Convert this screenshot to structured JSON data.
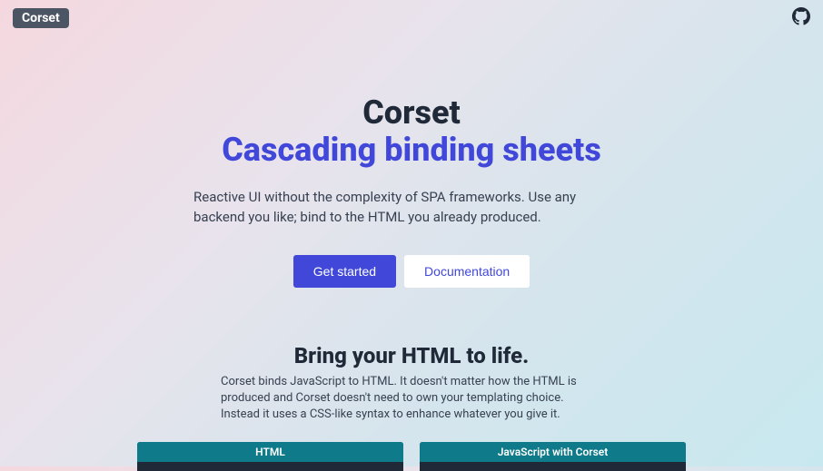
{
  "header": {
    "logo": "Corset"
  },
  "hero": {
    "title": "Corset",
    "subtitle": "Cascading binding sheets",
    "description": "Reactive UI without the complexity of SPA frameworks. Use any backend you like; bind to the HTML you already produced.",
    "buttons": {
      "primary": "Get started",
      "secondary": "Documentation"
    }
  },
  "section": {
    "title": "Bring your HTML to life.",
    "description": "Corset binds JavaScript to HTML. It doesn't matter how the HTML is produced and Corset doesn't need to own your templating choice. Instead it uses a CSS-like syntax to enhance whatever you give it."
  },
  "codePanels": {
    "left": "HTML",
    "right": "JavaScript with Corset"
  }
}
